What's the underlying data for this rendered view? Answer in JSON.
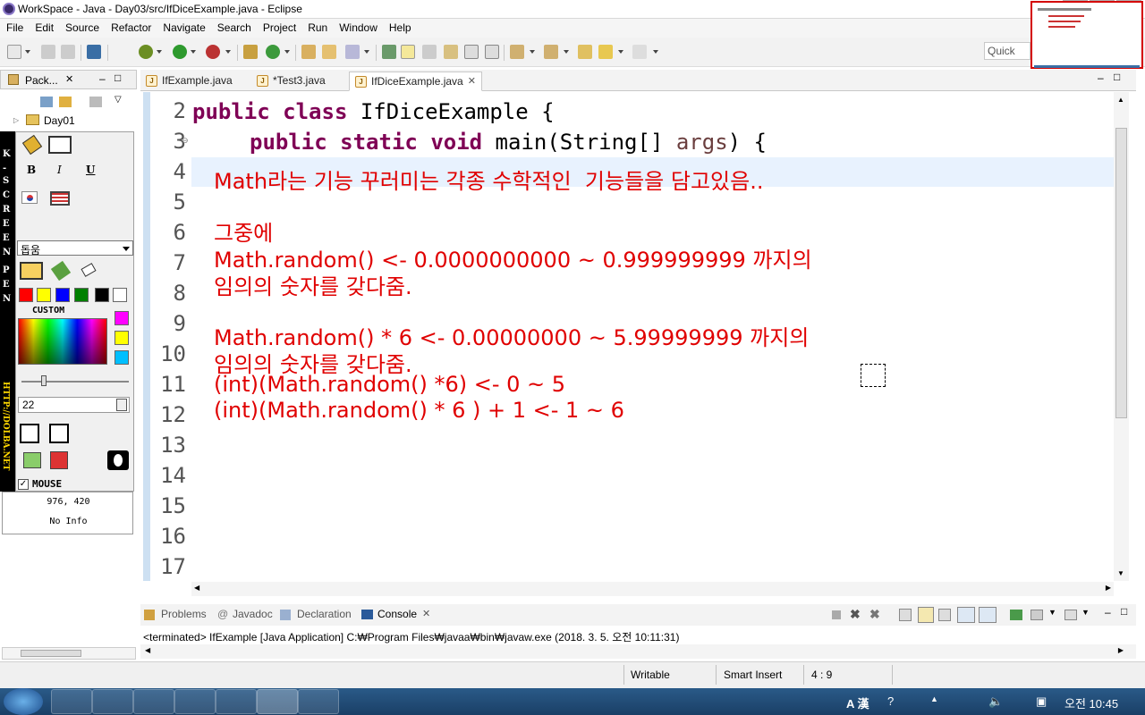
{
  "window": {
    "title": "WorkSpace - Java - Day03/src/IfDiceExample.java - Eclipse",
    "min": "–",
    "max": "□",
    "close": "✕"
  },
  "menu": [
    "File",
    "Edit",
    "Source",
    "Refactor",
    "Navigate",
    "Search",
    "Project",
    "Run",
    "Window",
    "Help"
  ],
  "quick_access": "Quick Ac",
  "package_explorer": {
    "title": "Pack...",
    "project": "Day01"
  },
  "tabs": [
    {
      "label": "IfExample.java",
      "active": false
    },
    {
      "label": "*Test3.java",
      "active": false
    },
    {
      "label": "IfDiceExample.java",
      "active": true
    }
  ],
  "line_numbers": [
    "2",
    "3",
    "4",
    "5",
    "6",
    "7",
    "8",
    "9",
    "10",
    "11",
    "12",
    "13",
    "14",
    "15",
    "16",
    "17"
  ],
  "code": {
    "line2": {
      "kw1": "public",
      "kw2": "class",
      "rest": " IfDiceExample {"
    },
    "line3": {
      "kw1": "public",
      "kw2": "static",
      "kw3": "void",
      "rest1": " main(String[] ",
      "param": "args",
      "rest2": ") {"
    }
  },
  "annotations": [
    "Math라는 기능 꾸러미는 각종 수학적인  기능들을 담고있음..",
    "그중에",
    "Math.random() <- 0.0000000000 ~ 0.999999999 까지의",
    "임의의 숫자를 갖다줌.",
    "Math.random() * 6 <- 0.00000000 ~ 5.99999999 까지의",
    "임의의 숫자를 갖다줌.",
    "(int)(Math.random() *6) <- 0 ~ 5",
    "(int)(Math.random() * 6 ) + 1 <- 1 ~ 6"
  ],
  "kspen": {
    "vertical_label": "K-SCREEN PEN",
    "url_label": "HTTP://DOLBA.NET",
    "bold": "B",
    "italic": "I",
    "underline": "U",
    "help_select": "돕움",
    "custom": "CUSTOM",
    "size": "22",
    "mouse": "MOUSE",
    "coords": "976, 420",
    "info": "No Info",
    "swatches": [
      "#ff0000",
      "#ffff00",
      "#0000ff",
      "#008000",
      "#000000",
      "#ffffff"
    ],
    "custom_swatches": [
      "#ff00ff",
      "#ffff00",
      "#00bfff"
    ]
  },
  "console": {
    "tabs": [
      "Problems",
      "Javadoc",
      "Declaration",
      "Console"
    ],
    "active": "Console",
    "line": "<terminated> IfExample [Java Application] C:₩Program Files₩javaa₩bin₩javaw.exe (2018. 3. 5. 오전 10:11:31)"
  },
  "status": {
    "writable": "Writable",
    "insert": "Smart Insert",
    "position": "4 : 9"
  },
  "taskbar": {
    "ime": "A 漢",
    "clock": "오전 10:45"
  }
}
